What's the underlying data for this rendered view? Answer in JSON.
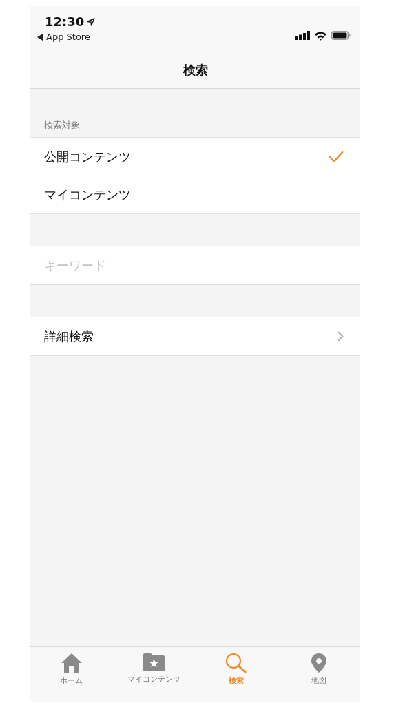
{
  "status_bar": {
    "time": "12:30",
    "back_label": "App Store"
  },
  "nav": {
    "title": "検索"
  },
  "scope_section": {
    "header": "検索対象",
    "options": [
      {
        "label": "公開コンテンツ",
        "selected": true
      },
      {
        "label": "マイコンテンツ",
        "selected": false
      }
    ]
  },
  "search_field": {
    "placeholder": "キーワード"
  },
  "advanced": {
    "label": "詳細検索"
  },
  "tab_bar": [
    {
      "kind": "home",
      "label": "ホーム",
      "selected": false
    },
    {
      "kind": "folder",
      "label": "マイコンテンツ",
      "selected": false
    },
    {
      "kind": "search",
      "label": "検索",
      "selected": true
    },
    {
      "kind": "map",
      "label": "地図",
      "selected": false
    }
  ]
}
